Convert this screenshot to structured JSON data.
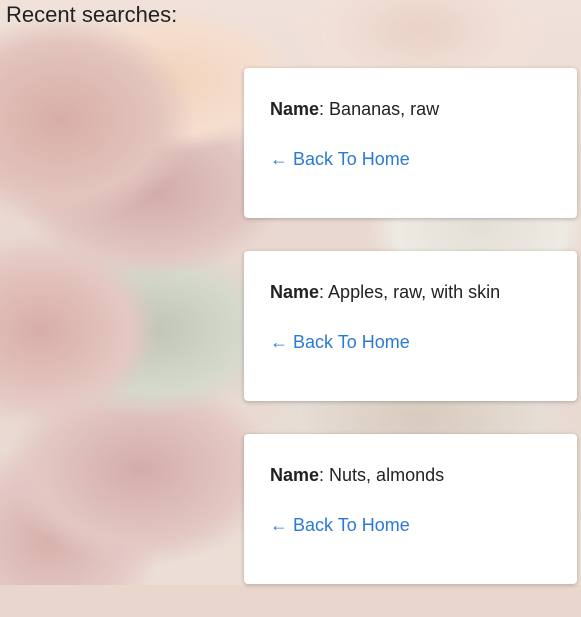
{
  "heading": "Recent searches:",
  "name_label": "Name",
  "cards": [
    {
      "name": "Bananas, raw",
      "back_link": "← Back To Home"
    },
    {
      "name": "Apples, raw, with skin",
      "back_link": "← Back To Home"
    },
    {
      "name": "Nuts, almonds",
      "back_link": "← Back To Home"
    }
  ],
  "colors": {
    "link": "#2a7bd6",
    "text": "#222222",
    "card_bg": "#ffffff"
  }
}
